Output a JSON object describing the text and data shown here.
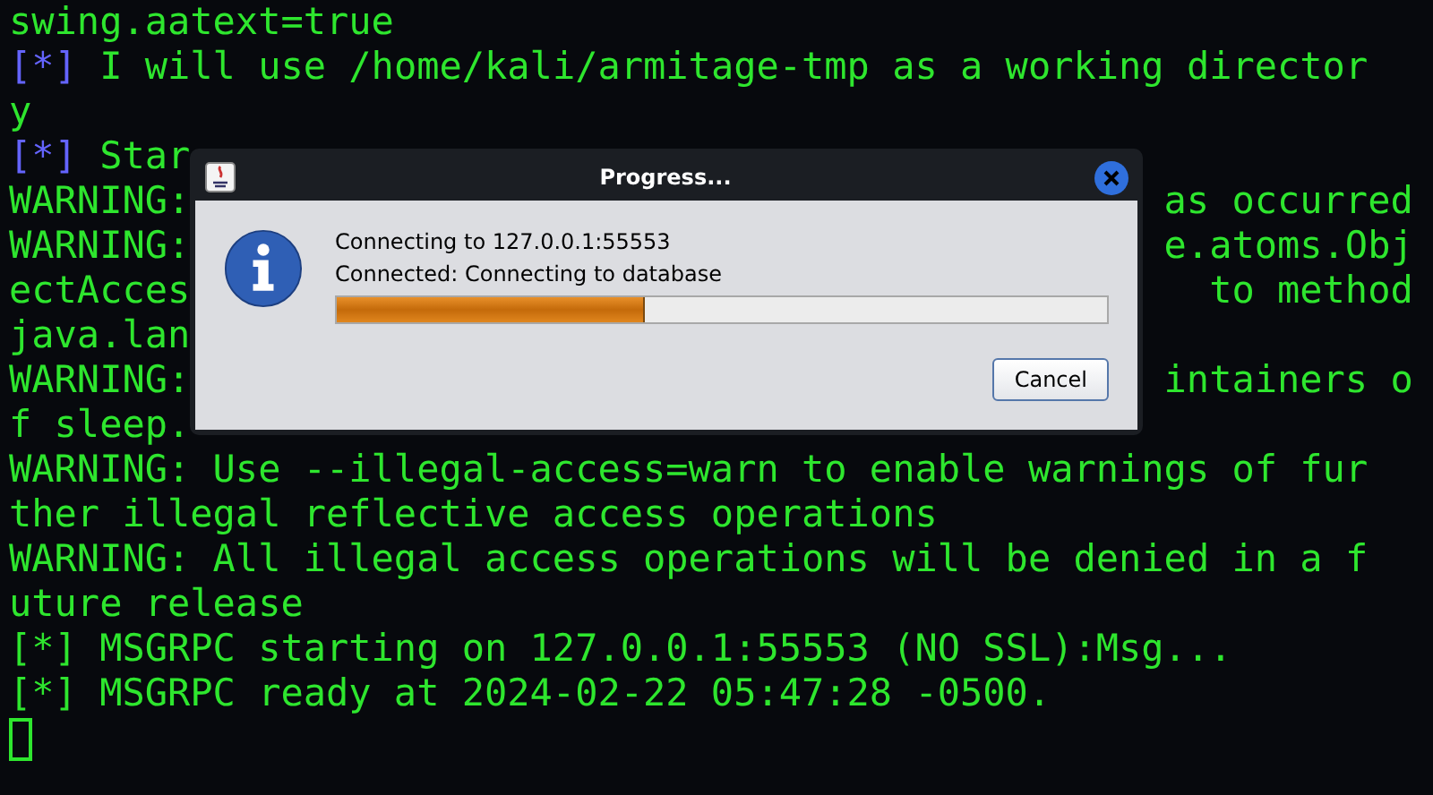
{
  "terminal": {
    "lines": [
      {
        "segments": [
          {
            "text": "swing.aatext=true",
            "color": "#2ee62e"
          }
        ]
      },
      {
        "segments": [
          {
            "text": "[*]",
            "color": "#6464ff"
          },
          {
            "text": " I will use /home/kali/armitage-tmp as a working director",
            "color": "#2ee62e"
          }
        ]
      },
      {
        "segments": [
          {
            "text": "y",
            "color": "#2ee62e"
          }
        ]
      },
      {
        "segments": [
          {
            "text": "[*]",
            "color": "#6464ff"
          },
          {
            "text": " Star",
            "color": "#2ee62e"
          }
        ]
      },
      {
        "segments": [
          {
            "text": "WARNING:",
            "color": "#2ee62e"
          }
        ],
        "right": "as occurred"
      },
      {
        "segments": [
          {
            "text": "WARNING:",
            "color": "#2ee62e"
          }
        ],
        "right": "e.atoms.Obj"
      },
      {
        "segments": [
          {
            "text": "ectAcces",
            "color": "#2ee62e"
          }
        ],
        "right": "to method"
      },
      {
        "segments": [
          {
            "text": "java.lan",
            "color": "#2ee62e"
          }
        ]
      },
      {
        "segments": [
          {
            "text": "WARNING:",
            "color": "#2ee62e"
          }
        ],
        "right": "intainers o"
      },
      {
        "segments": [
          {
            "text": "f sleep.",
            "color": "#2ee62e"
          }
        ]
      },
      {
        "segments": [
          {
            "text": "WARNING: Use --illegal-access=warn to enable warnings of fur",
            "color": "#2ee62e"
          }
        ]
      },
      {
        "segments": [
          {
            "text": "ther illegal reflective access operations",
            "color": "#2ee62e"
          }
        ]
      },
      {
        "segments": [
          {
            "text": "WARNING: All illegal access operations will be denied in a f",
            "color": "#2ee62e"
          }
        ]
      },
      {
        "segments": [
          {
            "text": "uture release",
            "color": "#2ee62e"
          }
        ]
      },
      {
        "segments": [
          {
            "text": "[*] MSGRPC starting on 127.0.0.1:55553 (NO SSL):Msg...",
            "color": "#2ee62e"
          }
        ]
      },
      {
        "segments": [
          {
            "text": "[*] MSGRPC ready at 2024-02-22 05:47:28 -0500.",
            "color": "#2ee62e"
          }
        ]
      }
    ],
    "cursor": true
  },
  "dialog": {
    "title": "Progress...",
    "message": "Connecting to 127.0.0.1:55553",
    "status": "Connected: Connecting to database",
    "progress": {
      "level": 0.4
    },
    "buttons": [
      "Cancel"
    ]
  }
}
